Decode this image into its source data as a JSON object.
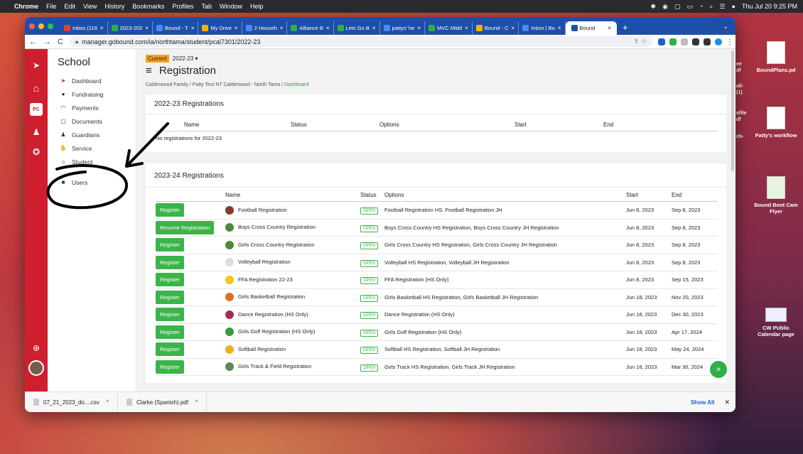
{
  "menubar": {
    "apple": "",
    "app": "Chrome",
    "items": [
      "File",
      "Edit",
      "View",
      "History",
      "Bookmarks",
      "Profiles",
      "Tab",
      "Window",
      "Help"
    ],
    "clock": "Thu Jul 20  9:25 PM"
  },
  "tabs": [
    {
      "label": "Inbox (116",
      "color": "#e34133"
    },
    {
      "label": "2023-202",
      "color": "#2fae4c"
    },
    {
      "label": "Bound - T",
      "color": "#4a8af4"
    },
    {
      "label": "My Drive",
      "color": "#f6b400"
    },
    {
      "label": "2 Househ",
      "color": "#4a8af4"
    },
    {
      "label": "Alliance B",
      "color": "#2fae4c"
    },
    {
      "label": "Lets Go B",
      "color": "#2fae4c"
    },
    {
      "label": "pattys' he",
      "color": "#4a8af4"
    },
    {
      "label": "MVC Midd",
      "color": "#2fae4c"
    },
    {
      "label": "Bound - C",
      "color": "#f6b400"
    },
    {
      "label": "Inbox | Bo",
      "color": "#4a8af4"
    }
  ],
  "active_tab": {
    "label": "Bound"
  },
  "address": {
    "url": "manager.gobound.com/ia/northtama/student/pcal7301/2022-23"
  },
  "rail": {
    "pc_label": "PC"
  },
  "sidebar": {
    "title": "School",
    "items": [
      {
        "label": "Dashboard"
      },
      {
        "label": "Fundraising"
      },
      {
        "label": "Payments"
      },
      {
        "label": "Documents"
      },
      {
        "label": "Guardians"
      },
      {
        "label": "Service"
      },
      {
        "label": "Student"
      },
      {
        "label": "Users"
      }
    ]
  },
  "page": {
    "current_badge": "Current",
    "season": "2022-23",
    "title": "Registration",
    "breadcrumb": {
      "family": "Calderwood Family",
      "sep": "/",
      "student": "Patty Test NT Calderwood - North Tama",
      "dashboard": "Dashboard"
    }
  },
  "reg2223": {
    "title": "2022-23 Registrations",
    "headers": [
      "Name",
      "Status",
      "Options",
      "Start",
      "End"
    ],
    "empty": "No registrations for 2022-23"
  },
  "reg2324": {
    "title": "2023-24 Registrations",
    "headers": [
      "",
      "Name",
      "Status",
      "Options",
      "Start",
      "End"
    ],
    "rows": [
      {
        "btn": "Register",
        "name": "Football Registration",
        "status": "OPEN",
        "options": "Football Registration HS, Football Registration JH",
        "start": "Jun 8, 2023",
        "end": "Sep 8, 2023",
        "icon_color": "#8a3a2a"
      },
      {
        "btn": "Resume Registration",
        "name": "Boys Cross Country Registration",
        "status": "OPEN",
        "options": "Boys Cross Country HS Registration, Boys Cross Country JH Registration",
        "start": "Jun 8, 2023",
        "end": "Sep 8, 2023",
        "icon_color": "#4a8a3a"
      },
      {
        "btn": "Register",
        "name": "Girls Cross Country Registration",
        "status": "OPEN",
        "options": "Girls Cross Country HS Registration, Girls Cross Country JH Registration",
        "start": "Jun 8, 2023",
        "end": "Sep 8, 2023",
        "icon_color": "#4a8a3a"
      },
      {
        "btn": "Register",
        "name": "Volleyball Registration",
        "status": "OPEN",
        "options": "Volleyball HS Registration, Volleyball JH Registration",
        "start": "Jun 8, 2023",
        "end": "Sep 8, 2023",
        "icon_color": "#dddddd"
      },
      {
        "btn": "Register",
        "name": "FFA Registration 22-23",
        "status": "OPEN",
        "options": "FFA Registration (HS Only)",
        "start": "Jun 8, 2023",
        "end": "Sep 15, 2023",
        "icon_color": "#f5c518"
      },
      {
        "btn": "Register",
        "name": "Girls Basketball Registration",
        "status": "OPEN",
        "options": "Girls Basketball HS Registration, Girls Basketball JH Registration",
        "start": "Jun 18, 2023",
        "end": "Nov 20, 2023",
        "icon_color": "#e07020"
      },
      {
        "btn": "Register",
        "name": "Dance Registration (HS Only)",
        "status": "OPEN",
        "options": "Dance Registration (HS Only)",
        "start": "Jun 18, 2023",
        "end": "Dec 30, 2023",
        "icon_color": "#a0304a"
      },
      {
        "btn": "Register",
        "name": "Girls Golf Registration (HS Only)",
        "status": "OPEN",
        "options": "Girls Golf Registration (HS Only)",
        "start": "Jun 18, 2023",
        "end": "Apr 17, 2024",
        "icon_color": "#3a9a3a"
      },
      {
        "btn": "Register",
        "name": "Softball Registration",
        "status": "OPEN",
        "options": "Softball HS Registration, Softball JH Registration",
        "start": "Jun 18, 2023",
        "end": "May 24, 2024",
        "icon_color": "#f0b020"
      },
      {
        "btn": "Register",
        "name": "Girls Track & Field Registration",
        "status": "OPEN",
        "options": "Girls Track HS Registration, Girls Track JH Registration",
        "start": "Jun 18, 2023",
        "end": "Mar 30, 2024",
        "icon_color": "#5a8a5a"
      }
    ]
  },
  "downloads": {
    "items": [
      {
        "label": "07_21_2023_do....csv"
      },
      {
        "label": "Clarke (Spanish).pdf"
      }
    ],
    "show_all": "Show All"
  },
  "desktop": {
    "icons": [
      {
        "label": "BoundPlans.pd"
      },
      {
        "label": "Patty's workflow"
      },
      {
        "label": "Bound Boot Cam Flyer"
      },
      {
        "label": "CW PUblic Calendar page"
      }
    ],
    "clipped": [
      "ee",
      "df",
      "all-",
      "(1)",
      "ofile",
      "df",
      "ch-"
    ]
  }
}
